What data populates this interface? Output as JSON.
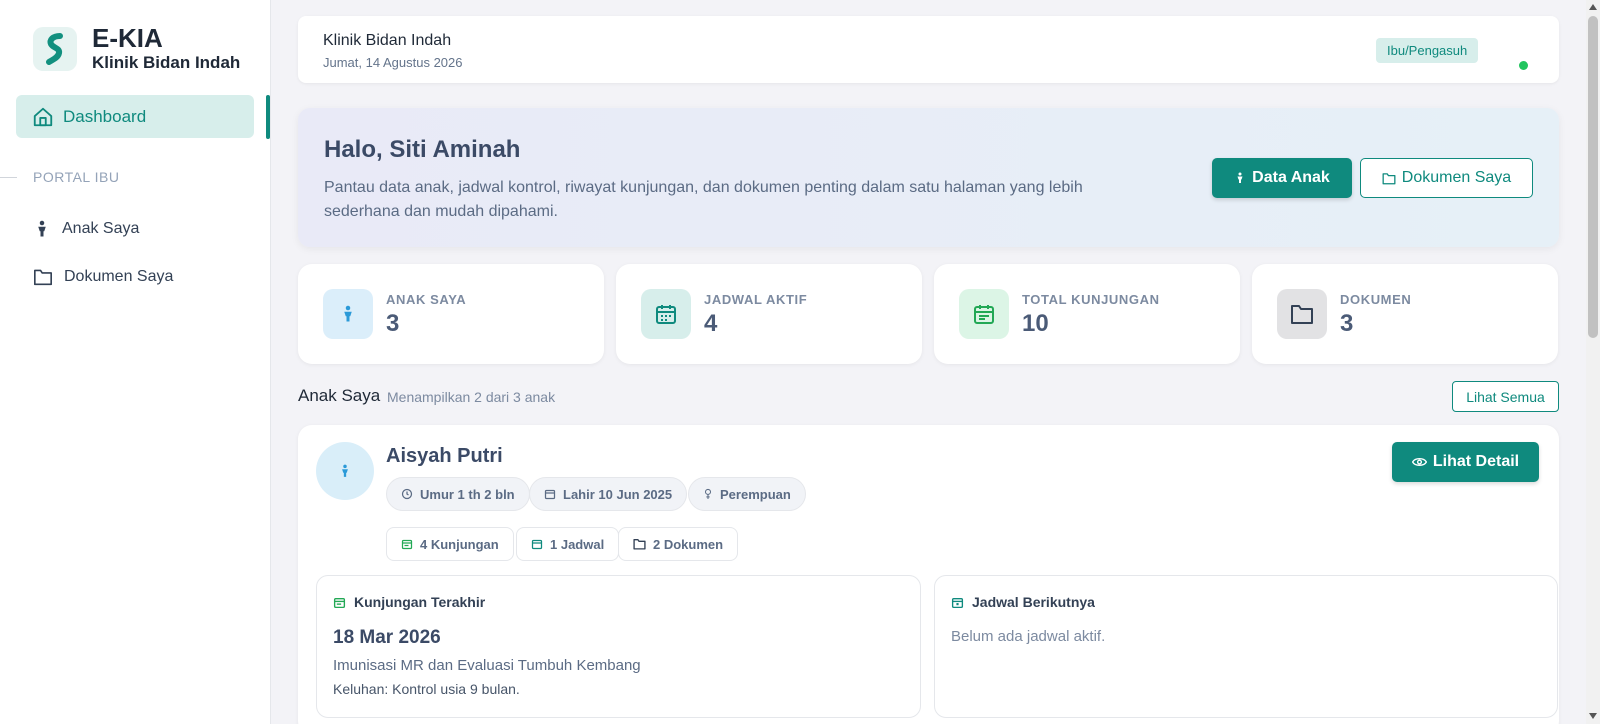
{
  "app": {
    "title": "E-KIA",
    "subtitle": "Klinik Bidan Indah"
  },
  "sidebar": {
    "active_item": "Dashboard",
    "section_label": "PORTAL IBU",
    "items": [
      {
        "label": "Anak Saya",
        "icon": "child-icon"
      },
      {
        "label": "Dokumen Saya",
        "icon": "folder-icon"
      }
    ]
  },
  "topbar": {
    "clinic": "Klinik Bidan Indah",
    "date": "Jumat, 14 Agustus 2026",
    "role": "Ibu/Pengasuh"
  },
  "hero": {
    "greeting": "Halo, Siti Aminah",
    "description": "Pantau data anak, jadwal kontrol, riwayat kunjungan, dan dokumen penting dalam satu halaman yang lebih sederhana dan mudah dipahami.",
    "primary_button": "Data Anak",
    "secondary_button": "Dokumen Saya"
  },
  "stats": [
    {
      "label": "ANAK SAYA",
      "value": "3",
      "icon": "child-icon",
      "color": "#dbeefa"
    },
    {
      "label": "JADWAL AKTIF",
      "value": "4",
      "icon": "calendar-icon",
      "color": "#d7eeeb"
    },
    {
      "label": "TOTAL KUNJUNGAN",
      "value": "10",
      "icon": "visit-icon",
      "color": "#dcf5e6"
    },
    {
      "label": "DOKUMEN",
      "value": "3",
      "icon": "folder-icon",
      "color": "#e2e2e4"
    }
  ],
  "children_section": {
    "title": "Anak Saya",
    "subtitle": "Menampilkan 2 dari 3 anak",
    "view_all": "Lihat Semua"
  },
  "child": {
    "name": "Aisyah Putri",
    "age": "Umur 1 th 2 bln",
    "birth": "Lahir 10 Jun 2025",
    "gender": "Perempuan",
    "visits": "4 Kunjungan",
    "schedules": "1 Jadwal",
    "documents": "2 Dokumen",
    "detail_button": "Lihat Detail",
    "last_visit": {
      "title": "Kunjungan Terakhir",
      "date": "18 Mar 2026",
      "service": "Imunisasi MR dan Evaluasi Tumbuh Kembang",
      "complaint": "Keluhan: Kontrol usia 9 bulan."
    },
    "next_schedule": {
      "title": "Jadwal Berikutnya",
      "empty": "Belum ada jadwal aktif."
    }
  },
  "colors": {
    "accent": "#0f8a7e",
    "accent_light": "#d7eeeb",
    "online": "#22c55e"
  }
}
